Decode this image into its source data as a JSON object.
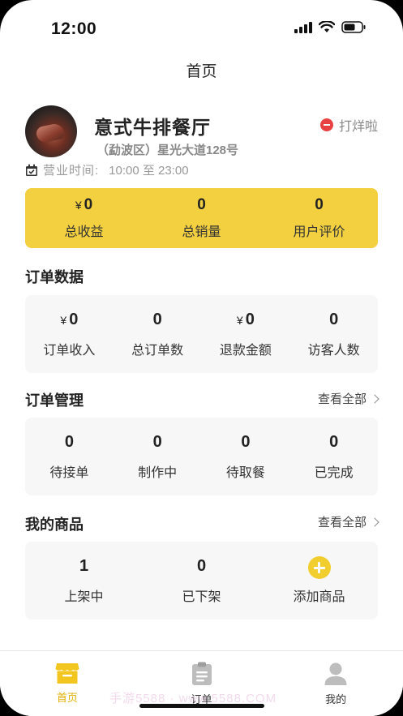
{
  "status_bar": {
    "time": "12:00"
  },
  "nav": {
    "title": "首页"
  },
  "shop": {
    "name": "意式牛排餐厅",
    "address": "（勐波区）星光大道128号",
    "status_label": "打烊啦",
    "hours_label": "营业时间:",
    "hours_value": "10:00 至 23:00"
  },
  "summary": {
    "currency": "¥",
    "items": [
      {
        "value": "0",
        "label": "总收益",
        "currency": true
      },
      {
        "value": "0",
        "label": "总销量",
        "currency": false
      },
      {
        "value": "0",
        "label": "用户评价",
        "currency": false
      }
    ]
  },
  "order_data": {
    "title": "订单数据",
    "items": [
      {
        "value": "0",
        "label": "订单收入",
        "currency": true
      },
      {
        "value": "0",
        "label": "总订单数",
        "currency": false
      },
      {
        "value": "0",
        "label": "退款金额",
        "currency": true
      },
      {
        "value": "0",
        "label": "访客人数",
        "currency": false
      }
    ]
  },
  "order_manage": {
    "title": "订单管理",
    "see_all": "查看全部",
    "items": [
      {
        "value": "0",
        "label": "待接单"
      },
      {
        "value": "0",
        "label": "制作中"
      },
      {
        "value": "0",
        "label": "待取餐"
      },
      {
        "value": "0",
        "label": "已完成"
      }
    ]
  },
  "products": {
    "title": "我的商品",
    "see_all": "查看全部",
    "items": [
      {
        "value": "1",
        "label": "上架中"
      },
      {
        "value": "0",
        "label": "已下架"
      }
    ],
    "add_label": "添加商品"
  },
  "tabbar": {
    "items": [
      {
        "label": "首页",
        "icon": "store-icon",
        "active": true
      },
      {
        "label": "订单",
        "icon": "clipboard-icon",
        "active": false
      },
      {
        "label": "我的",
        "icon": "user-icon",
        "active": false
      }
    ]
  },
  "watermark": "手游5588 · www.5588.COM",
  "colors": {
    "accent": "#f2d03f",
    "card_bg": "#f7f7f7",
    "status_red": "#e84141",
    "tab_active": "#e0b000"
  }
}
